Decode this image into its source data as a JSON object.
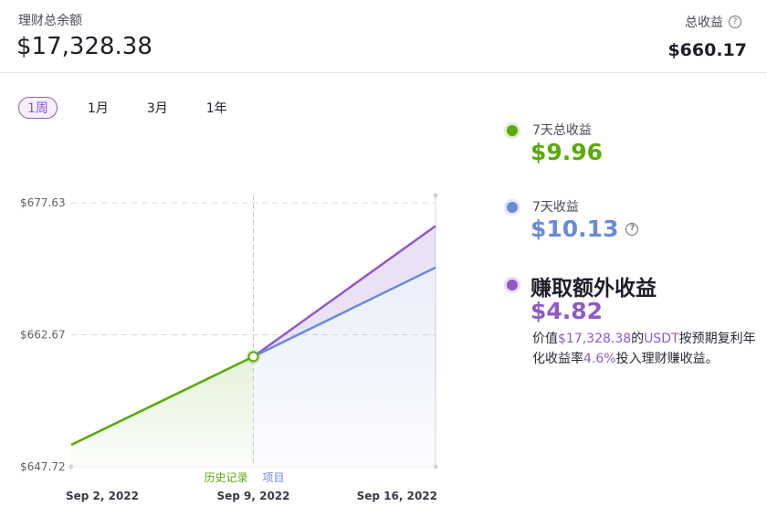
{
  "header": {
    "balance_label": "理财总余额",
    "balance_value": "$17,328.38",
    "total_income_label": "总收益",
    "total_income_value": "$660.17"
  },
  "tabs": [
    {
      "label": "1周",
      "active": true
    },
    {
      "label": "1月",
      "active": false
    },
    {
      "label": "3月",
      "active": false
    },
    {
      "label": "1年",
      "active": false
    }
  ],
  "legend": {
    "history": {
      "label": "7天总收益",
      "value": "$9.96",
      "color": "#5aaa0c"
    },
    "projected": {
      "label": "7天收益",
      "value": "$10.13",
      "color": "#6a8ad8"
    },
    "extra": {
      "title": "赚取额外收益",
      "value": "$4.82",
      "color": "#8f5ac8",
      "desc_1": "价值",
      "desc_amount": "$17,328.38",
      "desc_2": "的",
      "desc_asset": "USDT",
      "desc_3": "按预期复利年化收益率",
      "desc_rate": "4.6%",
      "desc_4": "投入理财赚收益。"
    }
  },
  "chart_data": {
    "type": "line",
    "x": [
      "Sep 2, 2022",
      "Sep 9, 2022",
      "Sep 16, 2022"
    ],
    "ylim": [
      647.72,
      677.63
    ],
    "y_ticks": [
      "$677.63",
      "$662.67",
      "$647.72"
    ],
    "y_tick_values": [
      677.63,
      662.67,
      647.72
    ],
    "region_labels": {
      "history": "历史记录",
      "projected": "项目"
    },
    "series": [
      {
        "key": "history",
        "color": "#5aaa0c",
        "points": [
          [
            "Sep 2, 2022",
            650.2
          ],
          [
            "Sep 9, 2022",
            660.2
          ]
        ]
      },
      {
        "key": "projected",
        "color": "#6a8ad8",
        "points": [
          [
            "Sep 9, 2022",
            660.2
          ],
          [
            "Sep 16, 2022",
            670.3
          ]
        ]
      },
      {
        "key": "extra",
        "color": "#8f5ac8",
        "points": [
          [
            "Sep 9, 2022",
            660.2
          ],
          [
            "Sep 16, 2022",
            675.0
          ]
        ]
      }
    ],
    "grid": true
  }
}
